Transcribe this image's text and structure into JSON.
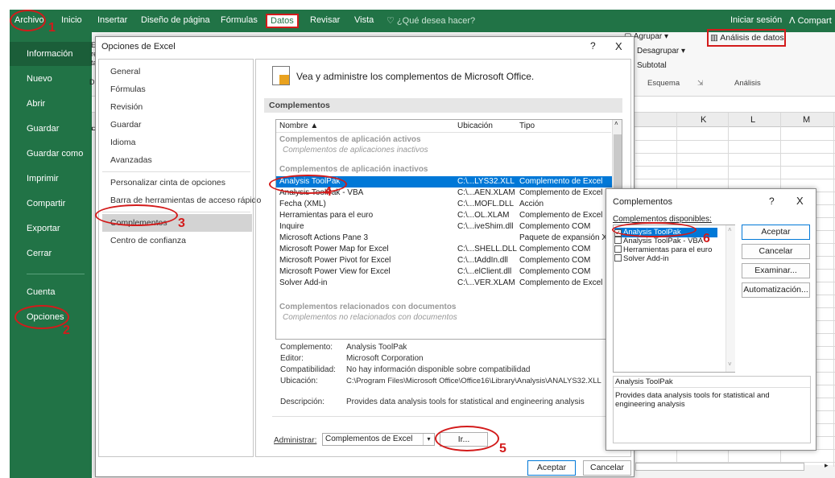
{
  "ribbon": {
    "tabs": {
      "archivo": "Archivo",
      "inicio": "Inicio",
      "insertar": "Insertar",
      "diseno": "Diseño de página",
      "formulas": "Fórmulas",
      "datos": "Datos",
      "revisar": "Revisar",
      "vista": "Vista",
      "search": "¿Qué desea hacer?"
    },
    "signin": "Iniciar sesión",
    "share": "Compart",
    "groups": {
      "agrupar": "Agrupar",
      "desagrupar": "Desagrupar",
      "subtotal": "Subtotal",
      "esquema": "Esquema",
      "analisis_datos": "Análisis de datos",
      "analisis": "Análisis"
    },
    "columns": [
      "K",
      "L",
      "M"
    ],
    "partial_letters": [
      "E",
      "re",
      "ta",
      "D",
      "E"
    ]
  },
  "backstage": {
    "items": [
      "Información",
      "Nuevo",
      "Abrir",
      "Guardar",
      "Guardar como",
      "Imprimir",
      "Compartir",
      "Exportar",
      "Cerrar"
    ],
    "cuenta": "Cuenta",
    "opciones": "Opciones"
  },
  "dialog": {
    "title": "Opciones de Excel",
    "help": "?",
    "close": "X",
    "nav": [
      "General",
      "Fórmulas",
      "Revisión",
      "Guardar",
      "Idioma",
      "Avanzadas",
      "Personalizar cinta de opciones",
      "Barra de herramientas de acceso rápido",
      "Complementos",
      "Centro de confianza"
    ],
    "intro": "Vea y administre los complementos de Microsoft Office.",
    "section": "Complementos",
    "columns": {
      "name": "Nombre ▲",
      "location": "Ubicación",
      "type": "Tipo"
    },
    "active_header": "Complementos de aplicación activos",
    "active_sub": "Complementos de aplicaciones inactivos",
    "inactive_header": "Complementos de aplicación inactivos",
    "rows": [
      {
        "name": "Analysis ToolPak",
        "location": "C:\\...LYS32.XLL",
        "type": "Complemento de Excel"
      },
      {
        "name": "Analysis ToolPak - VBA",
        "location": "C:\\...AEN.XLAM",
        "type": "Complemento de Excel"
      },
      {
        "name": "Fecha (XML)",
        "location": "C:\\...MOFL.DLL",
        "type": "Acción"
      },
      {
        "name": "Herramientas para el euro",
        "location": "C:\\...OL.XLAM",
        "type": "Complemento de Excel"
      },
      {
        "name": "Inquire",
        "location": "C:\\...iveShim.dll",
        "type": "Complemento COM"
      },
      {
        "name": "Microsoft Actions Pane 3",
        "location": "",
        "type": "Paquete de expansión XML"
      },
      {
        "name": "Microsoft Power Map for Excel",
        "location": "C:\\...SHELL.DLL",
        "type": "Complemento COM"
      },
      {
        "name": "Microsoft Power Pivot for Excel",
        "location": "C:\\...tAddIn.dll",
        "type": "Complemento COM"
      },
      {
        "name": "Microsoft Power View for Excel",
        "location": "C:\\...elClient.dll",
        "type": "Complemento COM"
      },
      {
        "name": "Solver Add-in",
        "location": "C:\\...VER.XLAM",
        "type": "Complemento de Excel"
      }
    ],
    "doc_header": "Complementos relacionados con documentos",
    "doc_sub": "Complementos no relacionados con documentos",
    "details": {
      "complemento_label": "Complemento:",
      "complemento": "Analysis ToolPak",
      "editor_label": "Editor:",
      "editor": "Microsoft Corporation",
      "compat_label": "Compatibilidad:",
      "compat": "No hay información disponible sobre compatibilidad",
      "ubicacion_label": "Ubicación:",
      "ubicacion": "C:\\Program Files\\Microsoft Office\\Office16\\Library\\Analysis\\ANALYS32.XLL",
      "desc_label": "Descripción:",
      "desc": "Provides data analysis tools for statistical and engineering analysis"
    },
    "administrar_label": "Administrar:",
    "administrar_value": "Complementos de Excel",
    "ir": "Ir...",
    "aceptar": "Aceptar",
    "cancelar": "Cancelar"
  },
  "dialog2": {
    "title": "Complementos",
    "help": "?",
    "close": "X",
    "available_label": "Complementos disponibles:",
    "items": [
      {
        "label": "Analysis ToolPak",
        "checked": true
      },
      {
        "label": "Analysis ToolPak - VBA",
        "checked": false
      },
      {
        "label": "Herramientas para el euro",
        "checked": false
      },
      {
        "label": "Solver Add-in",
        "checked": false
      }
    ],
    "aceptar": "Aceptar",
    "cancelar": "Cancelar",
    "examinar": "Examinar...",
    "automatizacion": "Automatización...",
    "info_title": "Analysis ToolPak",
    "info_text": "Provides data analysis tools for statistical and engineering analysis"
  },
  "annotations": [
    "1",
    "2",
    "3",
    "4",
    "5",
    "6"
  ],
  "colors": {
    "excel_green": "#217346",
    "selection_blue": "#0078d7",
    "annotation_red": "#d31b1b"
  }
}
